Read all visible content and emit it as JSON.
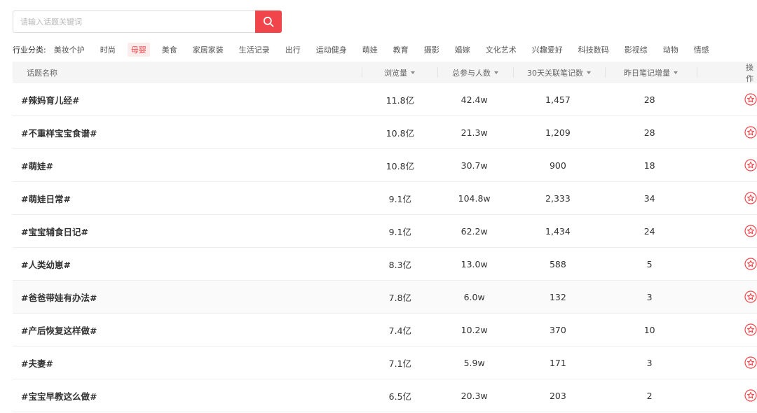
{
  "search": {
    "placeholder": "请输入话题关键词",
    "value": ""
  },
  "categories": {
    "label": "行业分类:",
    "items": [
      "美妆个护",
      "时尚",
      "母婴",
      "美食",
      "家居家装",
      "生活记录",
      "出行",
      "运动健身",
      "萌娃",
      "教育",
      "摄影",
      "婚嫁",
      "文化艺术",
      "兴趣爱好",
      "科技数码",
      "影视综",
      "动物",
      "情感"
    ],
    "active": "母婴"
  },
  "table": {
    "headers": {
      "name": "话题名称",
      "views": "浏览量",
      "participants": "总参与人数",
      "notes30": "30天关联笔记数",
      "yesterday": "昨日笔记增量",
      "action": "操作"
    },
    "rows": [
      {
        "name": "#辣妈育儿经#",
        "views": "11.8亿",
        "participants": "42.4w",
        "notes30": "1,457",
        "yesterday": "28"
      },
      {
        "name": "#不重样宝宝食谱#",
        "views": "10.8亿",
        "participants": "21.3w",
        "notes30": "1,209",
        "yesterday": "28"
      },
      {
        "name": "#萌娃#",
        "views": "10.8亿",
        "participants": "30.7w",
        "notes30": "900",
        "yesterday": "18"
      },
      {
        "name": "#萌娃日常#",
        "views": "9.1亿",
        "participants": "104.8w",
        "notes30": "2,333",
        "yesterday": "34"
      },
      {
        "name": "#宝宝辅食日记#",
        "views": "9.1亿",
        "participants": "62.2w",
        "notes30": "1,434",
        "yesterday": "24"
      },
      {
        "name": "#人类幼崽#",
        "views": "8.3亿",
        "participants": "13.0w",
        "notes30": "588",
        "yesterday": "5"
      },
      {
        "name": "#爸爸带娃有办法#",
        "views": "7.8亿",
        "participants": "6.0w",
        "notes30": "132",
        "yesterday": "3"
      },
      {
        "name": "#产后恢复这样做#",
        "views": "7.4亿",
        "participants": "10.2w",
        "notes30": "370",
        "yesterday": "10"
      },
      {
        "name": "#夫妻#",
        "views": "7.1亿",
        "participants": "5.9w",
        "notes30": "171",
        "yesterday": "3"
      },
      {
        "name": "#宝宝早教这么做#",
        "views": "6.5亿",
        "participants": "20.3w",
        "notes30": "203",
        "yesterday": "2"
      }
    ]
  },
  "icons": {
    "search": "search-icon",
    "sort": "caret-down-icon",
    "favorite": "star-circle-icon"
  },
  "colors": {
    "accent": "#f0454a",
    "header_bg": "#f5f5f5",
    "active_bg": "#fdecec"
  }
}
